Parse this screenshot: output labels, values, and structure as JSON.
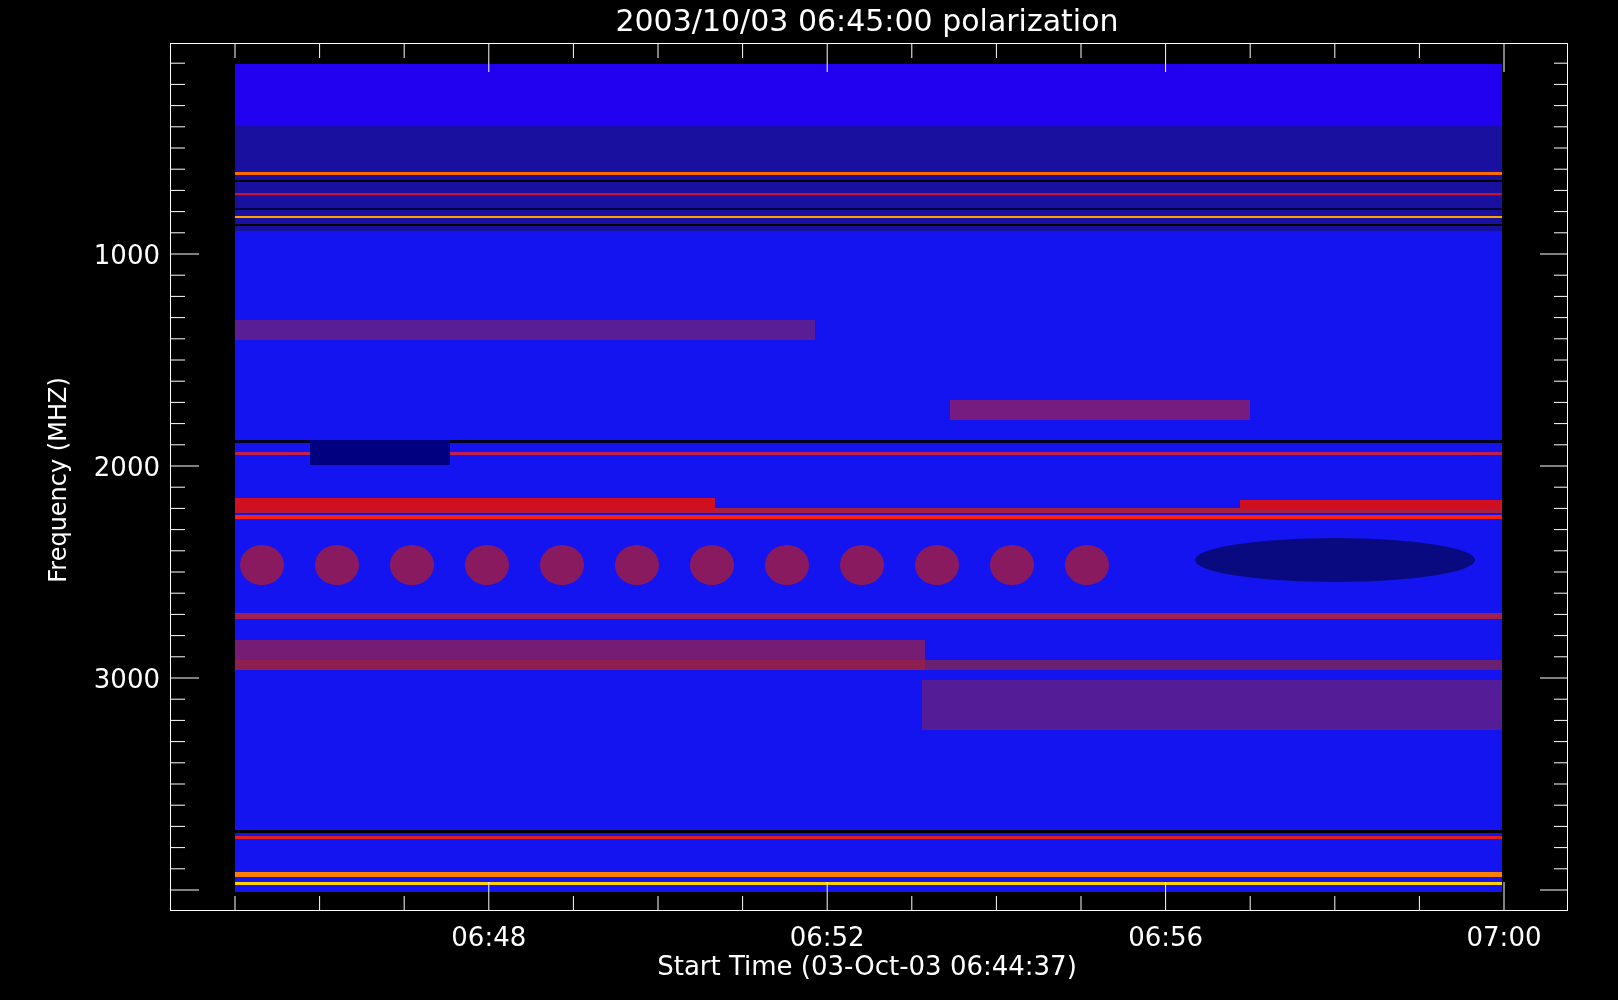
{
  "title": "2003/10/03 06:45:00 polarization",
  "y_axis": {
    "title": "Frequency (MHZ)",
    "tick_labels": [
      "1000",
      "2000",
      "3000"
    ]
  },
  "x_axis": {
    "title": "Start Time (03-Oct-03 06:44:37)",
    "tick_labels": [
      "06:48",
      "06:52",
      "06:56",
      "07:00"
    ]
  },
  "plot": {
    "kind": "spectrogram"
  }
}
